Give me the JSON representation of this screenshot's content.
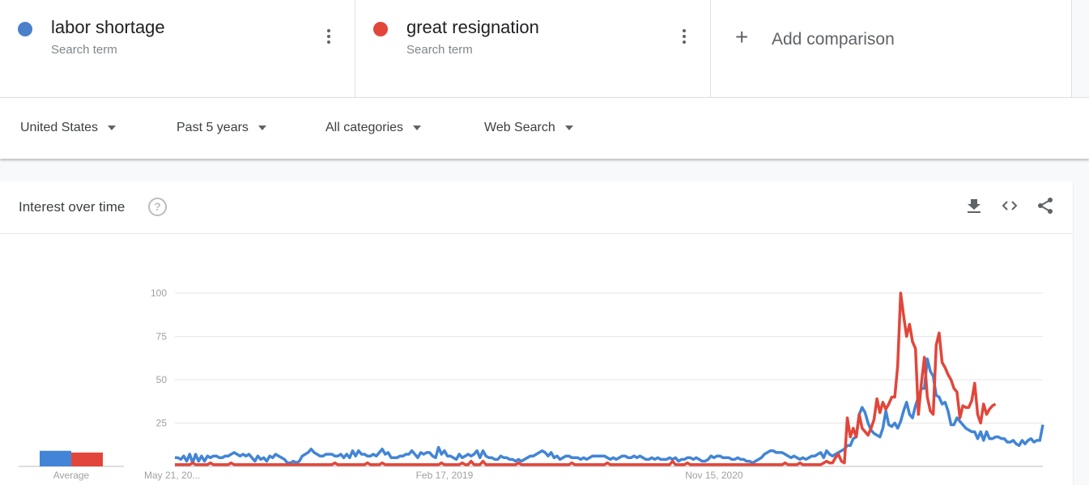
{
  "terms": [
    {
      "name": "labor shortage",
      "sub": "Search term",
      "color": "#4285d6"
    },
    {
      "name": "great resignation",
      "sub": "Search term",
      "color": "#e2463a"
    }
  ],
  "add_comparison": "Add comparison",
  "filters": [
    {
      "label": "United States"
    },
    {
      "label": "Past 5 years"
    },
    {
      "label": "All categories"
    },
    {
      "label": "Web Search"
    }
  ],
  "card": {
    "title": "Interest over time",
    "help": "?",
    "icons": [
      "download-icon",
      "embed-icon",
      "share-icon"
    ]
  },
  "chart_data": {
    "type": "line",
    "title": "Interest over time",
    "xlabel": "",
    "ylabel": "",
    "ylim": [
      0,
      100
    ],
    "yticks": [
      25,
      50,
      75,
      100
    ],
    "xtick_labels": [
      "May 21, 20...",
      "Feb 17, 2019",
      "Nov 15, 2020"
    ],
    "xtick_index": [
      0,
      91,
      182
    ],
    "grid": true,
    "legend": "top",
    "average": {
      "label": "Average",
      "values": [
        9,
        8
      ]
    },
    "series": [
      {
        "name": "labor shortage",
        "color": "#4285d6",
        "values": [
          5,
          5,
          4,
          6,
          3,
          7,
          2,
          7,
          3,
          6,
          3,
          6,
          5,
          6,
          6,
          5,
          5,
          6,
          6,
          7,
          8,
          7,
          6,
          7,
          6,
          7,
          5,
          3,
          6,
          4,
          5,
          3,
          6,
          5,
          7,
          6,
          5,
          4,
          2,
          2,
          3,
          2,
          3,
          6,
          7,
          8,
          10,
          8,
          7,
          6,
          6,
          7,
          7,
          7,
          6,
          6,
          7,
          5,
          7,
          5,
          9,
          6,
          9,
          7,
          7,
          6,
          6,
          7,
          6,
          8,
          10,
          7,
          8,
          5,
          5,
          5,
          6,
          6,
          7,
          7,
          9,
          7,
          5,
          8,
          7,
          8,
          8,
          6,
          5,
          11,
          7,
          9,
          6,
          6,
          5,
          4,
          7,
          5,
          6,
          7,
          6,
          7,
          9,
          5,
          9,
          6,
          5,
          5,
          4,
          4,
          6,
          5,
          5,
          4,
          4,
          3,
          4,
          3,
          4,
          5,
          6,
          6,
          7,
          8,
          9,
          8,
          6,
          8,
          5,
          6,
          4,
          5,
          6,
          6,
          5,
          5,
          5,
          4,
          5,
          4,
          5,
          6,
          6,
          6,
          6,
          6,
          5,
          4,
          5,
          4,
          5,
          6,
          6,
          5,
          5,
          6,
          5,
          6,
          5,
          4,
          4,
          5,
          4,
          5,
          4,
          4,
          4,
          5,
          4,
          5,
          3,
          4,
          4,
          5,
          5,
          4,
          5,
          4,
          3,
          3,
          4,
          6,
          5,
          6,
          6,
          5,
          5,
          5,
          4,
          4,
          5,
          4,
          4,
          3,
          3,
          2,
          3,
          4,
          5,
          7,
          8,
          9,
          9,
          8,
          8,
          8,
          7,
          6,
          5,
          6,
          5,
          4,
          5,
          4,
          5,
          6,
          6,
          7,
          8,
          5,
          9,
          7,
          6,
          7,
          8,
          9,
          10,
          12,
          12,
          16,
          17,
          30,
          34,
          31,
          25,
          21,
          19,
          18,
          17,
          22,
          32,
          24,
          23,
          25,
          22,
          26,
          32,
          37,
          30,
          28,
          35,
          40,
          45,
          45,
          62,
          55,
          52,
          41,
          40,
          36,
          37,
          32,
          24,
          24,
          28,
          26,
          24,
          22,
          21,
          20,
          20,
          16,
          20,
          15,
          20,
          16,
          16,
          17,
          17,
          16,
          16,
          14,
          14,
          15,
          13,
          12,
          15,
          13,
          15,
          16,
          14,
          15,
          15,
          24
        ]
      },
      {
        "name": "great resignation",
        "color": "#e2463a",
        "values": [
          1,
          1,
          1,
          1,
          1,
          1,
          2,
          1,
          1,
          1,
          1,
          1,
          2,
          1,
          1,
          1,
          1,
          1,
          1,
          2,
          1,
          1,
          1,
          1,
          1,
          1,
          1,
          1,
          1,
          1,
          1,
          1,
          1,
          1,
          1,
          1,
          1,
          1,
          1,
          1,
          1,
          1,
          1,
          1,
          1,
          1,
          1,
          1,
          1,
          1,
          1,
          1,
          1,
          1,
          2,
          1,
          1,
          1,
          1,
          1,
          1,
          1,
          1,
          1,
          1,
          2,
          1,
          1,
          1,
          1,
          2,
          1,
          1,
          1,
          1,
          1,
          1,
          1,
          1,
          1,
          1,
          1,
          1,
          1,
          1,
          1,
          1,
          1,
          1,
          1,
          2,
          1,
          1,
          1,
          1,
          1,
          1,
          2,
          1,
          1,
          3,
          1,
          1,
          1,
          3,
          1,
          1,
          1,
          1,
          1,
          1,
          1,
          1,
          1,
          1,
          1,
          2,
          1,
          1,
          1,
          1,
          1,
          1,
          1,
          1,
          1,
          1,
          1,
          1,
          1,
          1,
          1,
          1,
          1,
          2,
          1,
          1,
          1,
          1,
          1,
          1,
          1,
          1,
          1,
          1,
          1,
          2,
          1,
          1,
          1,
          1,
          1,
          1,
          1,
          1,
          1,
          1,
          1,
          1,
          1,
          1,
          1,
          1,
          1,
          1,
          1,
          1,
          1,
          3,
          1,
          1,
          1,
          1,
          2,
          1,
          1,
          1,
          1,
          1,
          1,
          1,
          1,
          1,
          1,
          1,
          1,
          1,
          1,
          1,
          1,
          1,
          1,
          1,
          1,
          1,
          1,
          1,
          1,
          1,
          1,
          1,
          1,
          1,
          1,
          1,
          1,
          2,
          1,
          1,
          1,
          1,
          2,
          1,
          1,
          1,
          1,
          1,
          1,
          1,
          2,
          3,
          2,
          2,
          5,
          7,
          3,
          2,
          28,
          17,
          22,
          17,
          30,
          22,
          20,
          18,
          22,
          27,
          39,
          31,
          37,
          33,
          36,
          40,
          40,
          58,
          100,
          87,
          75,
          82,
          72,
          68,
          30,
          48,
          63,
          40,
          32,
          30,
          70,
          77,
          60,
          57,
          53,
          50,
          45,
          43,
          28,
          35,
          34,
          34,
          38,
          48,
          30,
          25,
          36,
          30,
          33,
          35,
          36
        ]
      }
    ]
  }
}
